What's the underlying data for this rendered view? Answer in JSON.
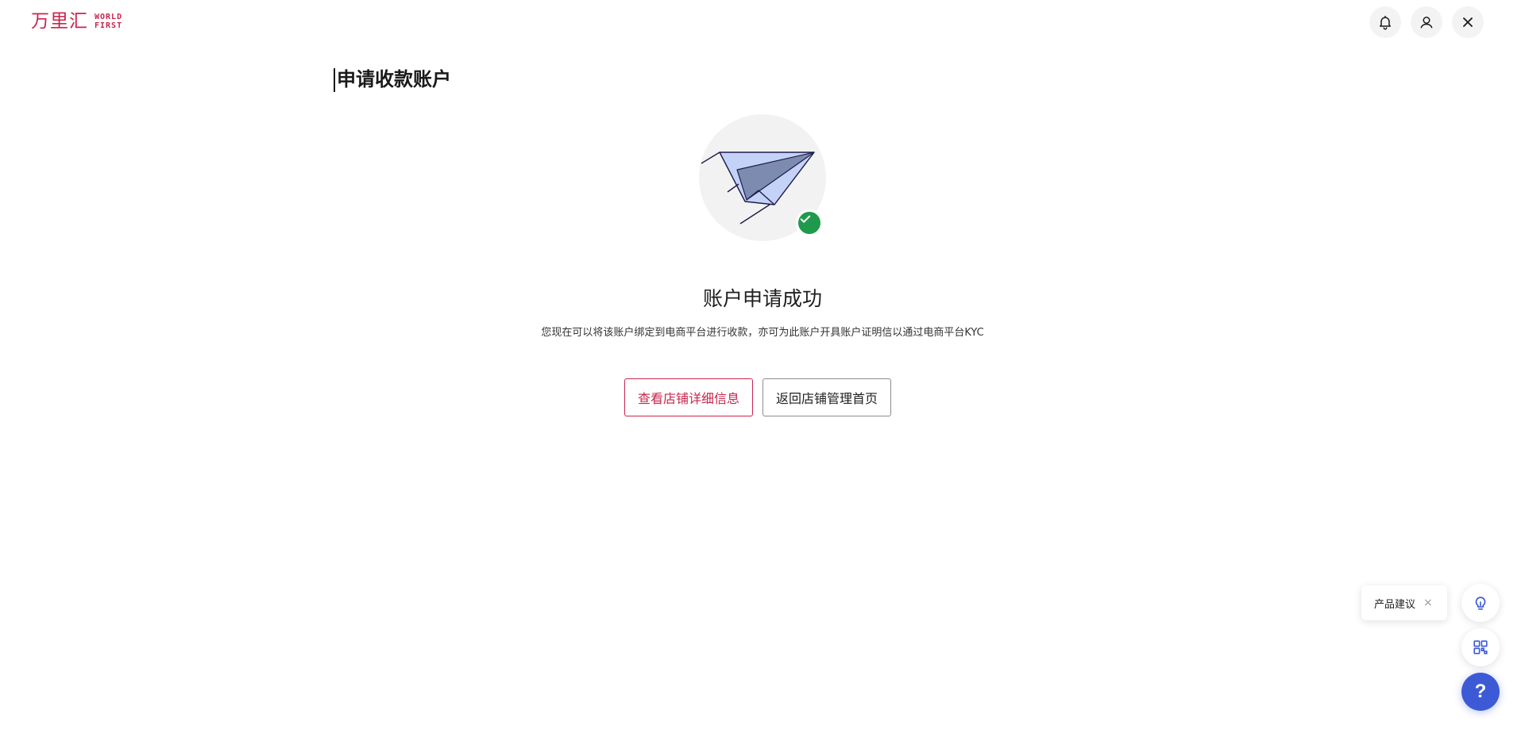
{
  "brand": {
    "name_cn": "万里汇",
    "name_en_line1": "WORLD",
    "name_en_line2": "FIRST",
    "accent_color": "#c8264c"
  },
  "header": {
    "icons": [
      "bell-icon",
      "user-icon",
      "close-icon"
    ]
  },
  "page": {
    "title": "申请收款账户"
  },
  "result": {
    "illustration": "paper-plane-icon",
    "status_icon": "check-icon",
    "title": "账户申请成功",
    "description": "您现在可以将该账户绑定到电商平台进行收款，亦可为此账户开具账户证明信以通过电商平台KYC"
  },
  "actions": {
    "view_store_label": "查看店铺详细信息",
    "back_home_label": "返回店铺管理首页"
  },
  "floating": {
    "feedback_label": "产品建议",
    "feedback_close": "×",
    "help_label": "?",
    "icons": [
      "lightbulb-icon",
      "apps-grid-icon",
      "help-icon"
    ],
    "help_color": "#3d5ad6"
  }
}
